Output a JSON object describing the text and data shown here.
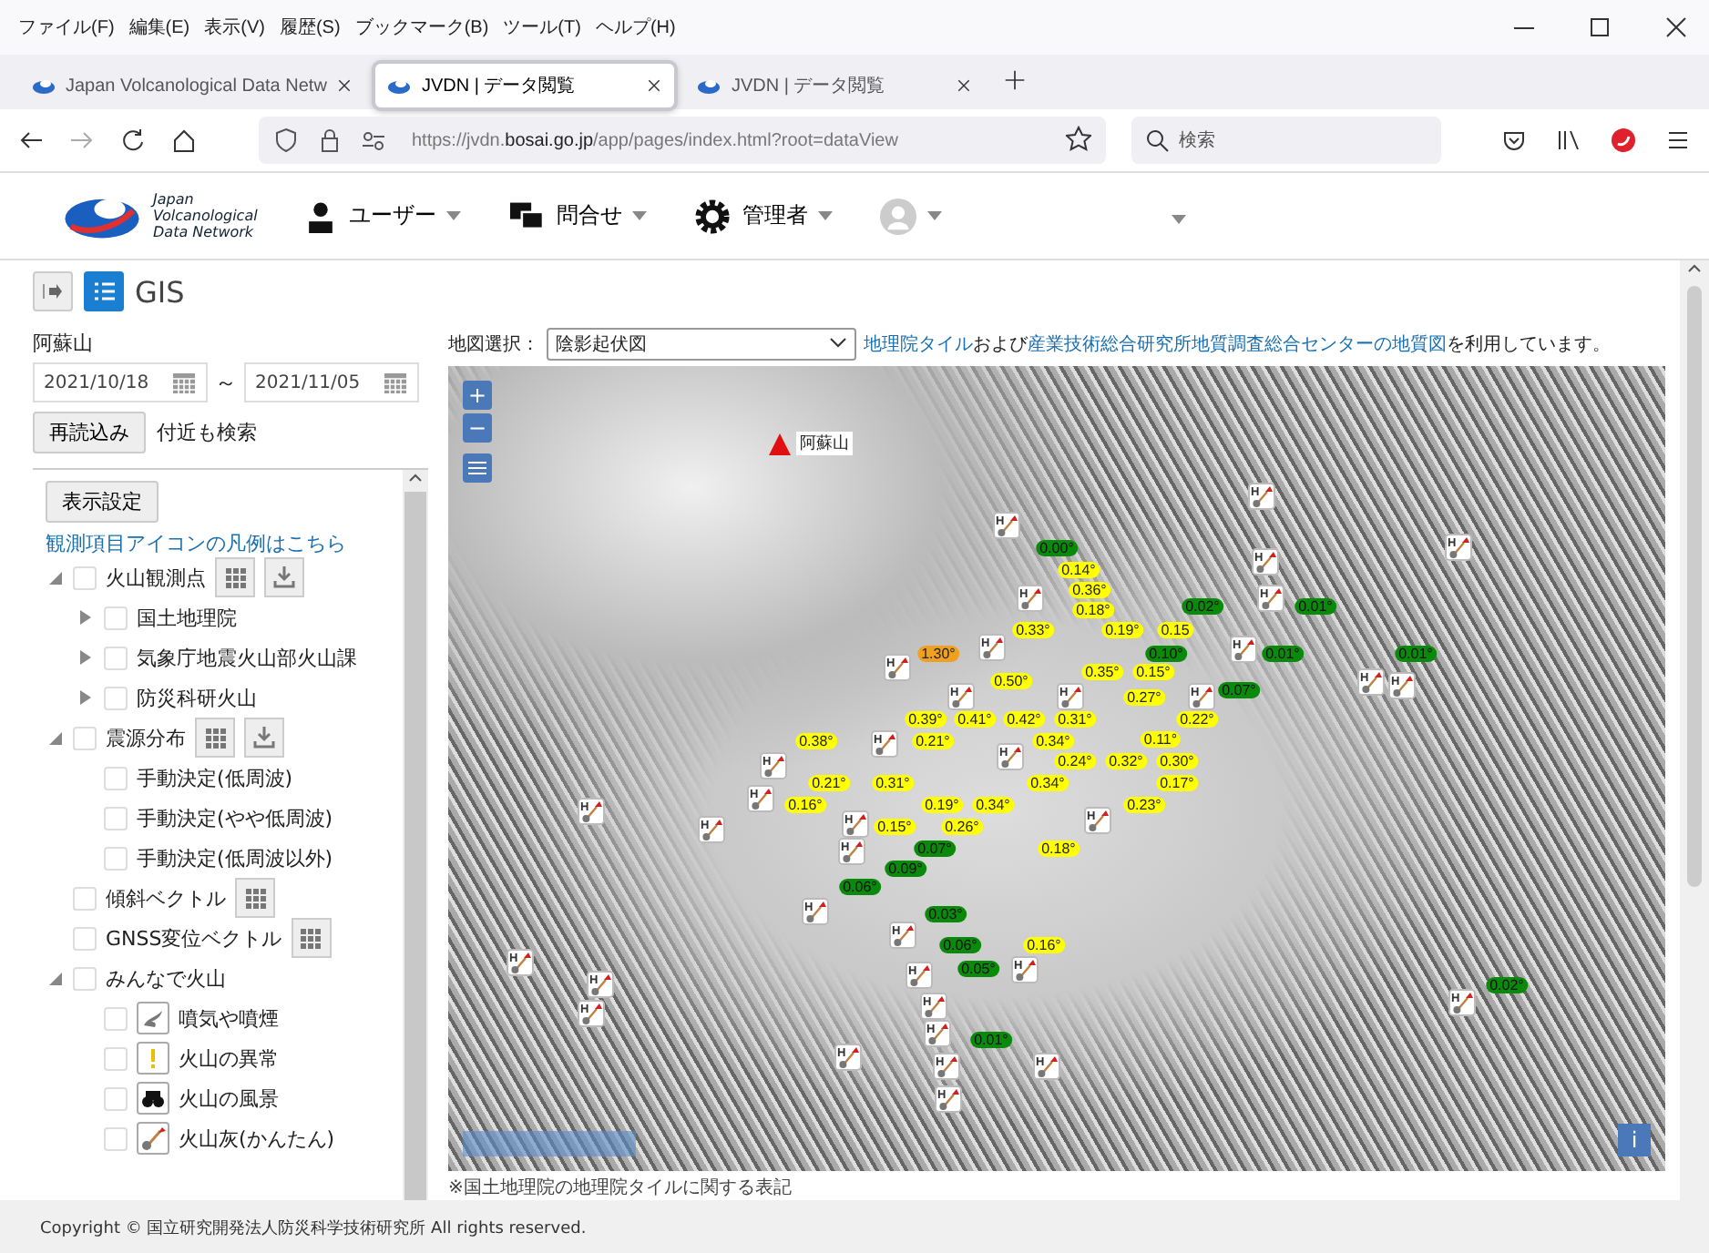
{
  "browser": {
    "menu": [
      "ファイル(F)",
      "編集(E)",
      "表示(V)",
      "履歴(S)",
      "ブックマーク(B)",
      "ツール(T)",
      "ヘルプ(H)"
    ],
    "tabs": [
      {
        "title": "Japan Volcanological Data Netw",
        "selected": false
      },
      {
        "title": "JVDN | データ閲覧",
        "selected": true
      },
      {
        "title": "JVDN | データ閲覧",
        "selected": false
      }
    ],
    "url": "https://jvdn.**bosai.go.jp**/app/pages/index.html?root=dataView",
    "search": {
      "placeholder": "検索"
    }
  },
  "app_header": {
    "logo_text": [
      "Japan",
      "Volcanological",
      "Data Network"
    ],
    "menus": [
      {
        "label": "ユーザー",
        "kind": "user"
      },
      {
        "label": "問合せ",
        "kind": "chat"
      },
      {
        "label": "管理者",
        "kind": "gear"
      },
      {
        "kind": "avatar"
      }
    ]
  },
  "side": {
    "title": "GIS",
    "volcano": "阿蘇山",
    "date_from": "2021/10/18",
    "separator": "～",
    "date_to": "2021/11/05",
    "reload_button": "再読込み",
    "nearby_label": "付近も検索",
    "display_button": "表示設定",
    "legend_link": "観測項目アイコンの凡例はこちら",
    "layers": [
      {
        "label": "火山観測点",
        "checked": false,
        "expanded": true,
        "actions": [
          {
            "kind": "grid"
          },
          {
            "kind": "download"
          }
        ],
        "children": [
          {
            "label": "国土地理院",
            "checked": false,
            "expanded": false
          },
          {
            "label": "気象庁地震火山部火山課",
            "checked": false,
            "expanded": false
          },
          {
            "label": "防災科研火山",
            "checked": false,
            "expanded": false
          }
        ]
      },
      {
        "label": "震源分布",
        "checked": false,
        "expanded": true,
        "actions": [
          {
            "kind": "grid"
          },
          {
            "kind": "download"
          }
        ],
        "children": [
          {
            "label": "手動決定(低周波)",
            "checked": false
          },
          {
            "label": "手動決定(やや低周波)",
            "checked": false
          },
          {
            "label": "手動決定(低周波以外)",
            "checked": false
          }
        ]
      },
      {
        "label": "傾斜ベクトル",
        "checked": false,
        "actions": [
          {
            "kind": "grid"
          }
        ]
      },
      {
        "label": "GNSS変位ベクトル",
        "checked": false,
        "actions": [
          {
            "kind": "grid"
          }
        ]
      },
      {
        "label": "みんなで火山",
        "checked": false,
        "expanded": true,
        "children": [
          {
            "label": "噴気や噴煙",
            "checked": false,
            "kind": "plume"
          },
          {
            "label": "火山の異常",
            "checked": false,
            "kind": "alert"
          },
          {
            "label": "火山の風景",
            "checked": false,
            "kind": "binoculars"
          },
          {
            "label": "火山灰(かんたん)",
            "checked": false,
            "kind": "ash"
          }
        ]
      }
    ]
  },
  "map_bar": {
    "label": "地図選択：",
    "select_value": "陰影起伏図",
    "credit": [
      {
        "text": "地理院タイル",
        "link": true
      },
      {
        "text": "および",
        "link": false
      },
      {
        "text": "産業技術総合研究所地質調査総合センターの地質図",
        "link": true
      },
      {
        "text": "を利用しています。",
        "link": false
      }
    ]
  },
  "map": {
    "zoom_in": "+",
    "zoom_out": "−",
    "info": "i",
    "volcano_label": "阿蘇山",
    "caption": "※国土地理院の地理院タイルに関する表記",
    "stations": [
      {
        "mark": "H"
      },
      {
        "mark": "H"
      },
      {
        "mark": "H"
      },
      {
        "mark": "H"
      },
      {
        "mark": "H"
      },
      {
        "mark": "H"
      },
      {
        "mark": "H"
      },
      {
        "mark": "H"
      },
      {
        "mark": "H"
      },
      {
        "mark": "H"
      },
      {
        "mark": "H"
      },
      {
        "mark": "H"
      },
      {
        "mark": "H"
      },
      {
        "mark": "H"
      },
      {
        "mark": "H"
      },
      {
        "mark": "H"
      },
      {
        "mark": "H"
      },
      {
        "mark": "H"
      },
      {
        "mark": "H"
      },
      {
        "mark": "H"
      },
      {
        "mark": "H"
      },
      {
        "mark": "H"
      },
      {
        "mark": "H"
      },
      {
        "mark": "H"
      },
      {
        "mark": "H"
      },
      {
        "mark": "H"
      },
      {
        "mark": "H"
      },
      {
        "mark": "H"
      },
      {
        "mark": "H"
      },
      {
        "mark": "H"
      },
      {
        "mark": "H"
      },
      {
        "mark": "H"
      },
      {
        "mark": "H"
      },
      {
        "mark": "H"
      },
      {
        "mark": "H"
      },
      {
        "mark": "H"
      },
      {
        "mark": "H"
      }
    ],
    "readings": [
      {
        "text": "0.00°",
        "color": "#0a8a0a"
      },
      {
        "text": "0.14°",
        "color": "#ffff00"
      },
      {
        "text": "0.36°",
        "color": "#ffff00"
      },
      {
        "text": "0.18°",
        "color": "#ffff00"
      },
      {
        "text": "0.02°",
        "color": "#0a8a0a"
      },
      {
        "text": "0.01°",
        "color": "#0a8a0a"
      },
      {
        "text": "0.33°",
        "color": "#ffff00"
      },
      {
        "text": "0.19°",
        "color": "#ffff00"
      },
      {
        "text": "0.15",
        "color": "#ffff00"
      },
      {
        "text": "1.30°",
        "color": "#f0a020"
      },
      {
        "text": "0.10°",
        "color": "#0a8a0a"
      },
      {
        "text": "0.01°",
        "color": "#0a8a0a"
      },
      {
        "text": "0.01°",
        "color": "#0a8a0a"
      },
      {
        "text": "0.35°",
        "color": "#ffff00"
      },
      {
        "text": "0.15°",
        "color": "#ffff00"
      },
      {
        "text": "0.50°",
        "color": "#ffff00"
      },
      {
        "text": "0.07°",
        "color": "#0a8a0a"
      },
      {
        "text": "0.27°",
        "color": "#ffff00"
      },
      {
        "text": "0.39°",
        "color": "#ffff00"
      },
      {
        "text": "0.41°",
        "color": "#ffff00"
      },
      {
        "text": "0.42°",
        "color": "#ffff00"
      },
      {
        "text": "0.31°",
        "color": "#ffff00"
      },
      {
        "text": "0.22°",
        "color": "#ffff00"
      },
      {
        "text": "0.38°",
        "color": "#ffff00"
      },
      {
        "text": "0.21°",
        "color": "#ffff00"
      },
      {
        "text": "0.34°",
        "color": "#ffff00"
      },
      {
        "text": "0.11°",
        "color": "#ffff00"
      },
      {
        "text": "0.24°",
        "color": "#ffff00"
      },
      {
        "text": "0.32°",
        "color": "#ffff00"
      },
      {
        "text": "0.30°",
        "color": "#ffff00"
      },
      {
        "text": "0.21°",
        "color": "#ffff00"
      },
      {
        "text": "0.31°",
        "color": "#ffff00"
      },
      {
        "text": "0.34°",
        "color": "#ffff00"
      },
      {
        "text": "0.17°",
        "color": "#ffff00"
      },
      {
        "text": "0.16°",
        "color": "#ffff00"
      },
      {
        "text": "0.19°",
        "color": "#ffff00"
      },
      {
        "text": "0.34°",
        "color": "#ffff00"
      },
      {
        "text": "0.23°",
        "color": "#ffff00"
      },
      {
        "text": "0.15°",
        "color": "#ffff00"
      },
      {
        "text": "0.26°",
        "color": "#ffff00"
      },
      {
        "text": "0.07°",
        "color": "#0a8a0a"
      },
      {
        "text": "0.18°",
        "color": "#ffff00"
      },
      {
        "text": "0.09°",
        "color": "#0a8a0a"
      },
      {
        "text": "0.06°",
        "color": "#0a8a0a"
      },
      {
        "text": "0.03°",
        "color": "#0a8a0a"
      },
      {
        "text": "0.06°",
        "color": "#0a8a0a"
      },
      {
        "text": "0.16°",
        "color": "#ffff00"
      },
      {
        "text": "0.05°",
        "color": "#0a8a0a"
      },
      {
        "text": "0.02°",
        "color": "#0a8a0a"
      },
      {
        "text": "0.01°",
        "color": "#0a8a0a"
      }
    ]
  },
  "footer": "Copyright © 国立研究開発法人防災科学技術研究所 All rights reserved."
}
